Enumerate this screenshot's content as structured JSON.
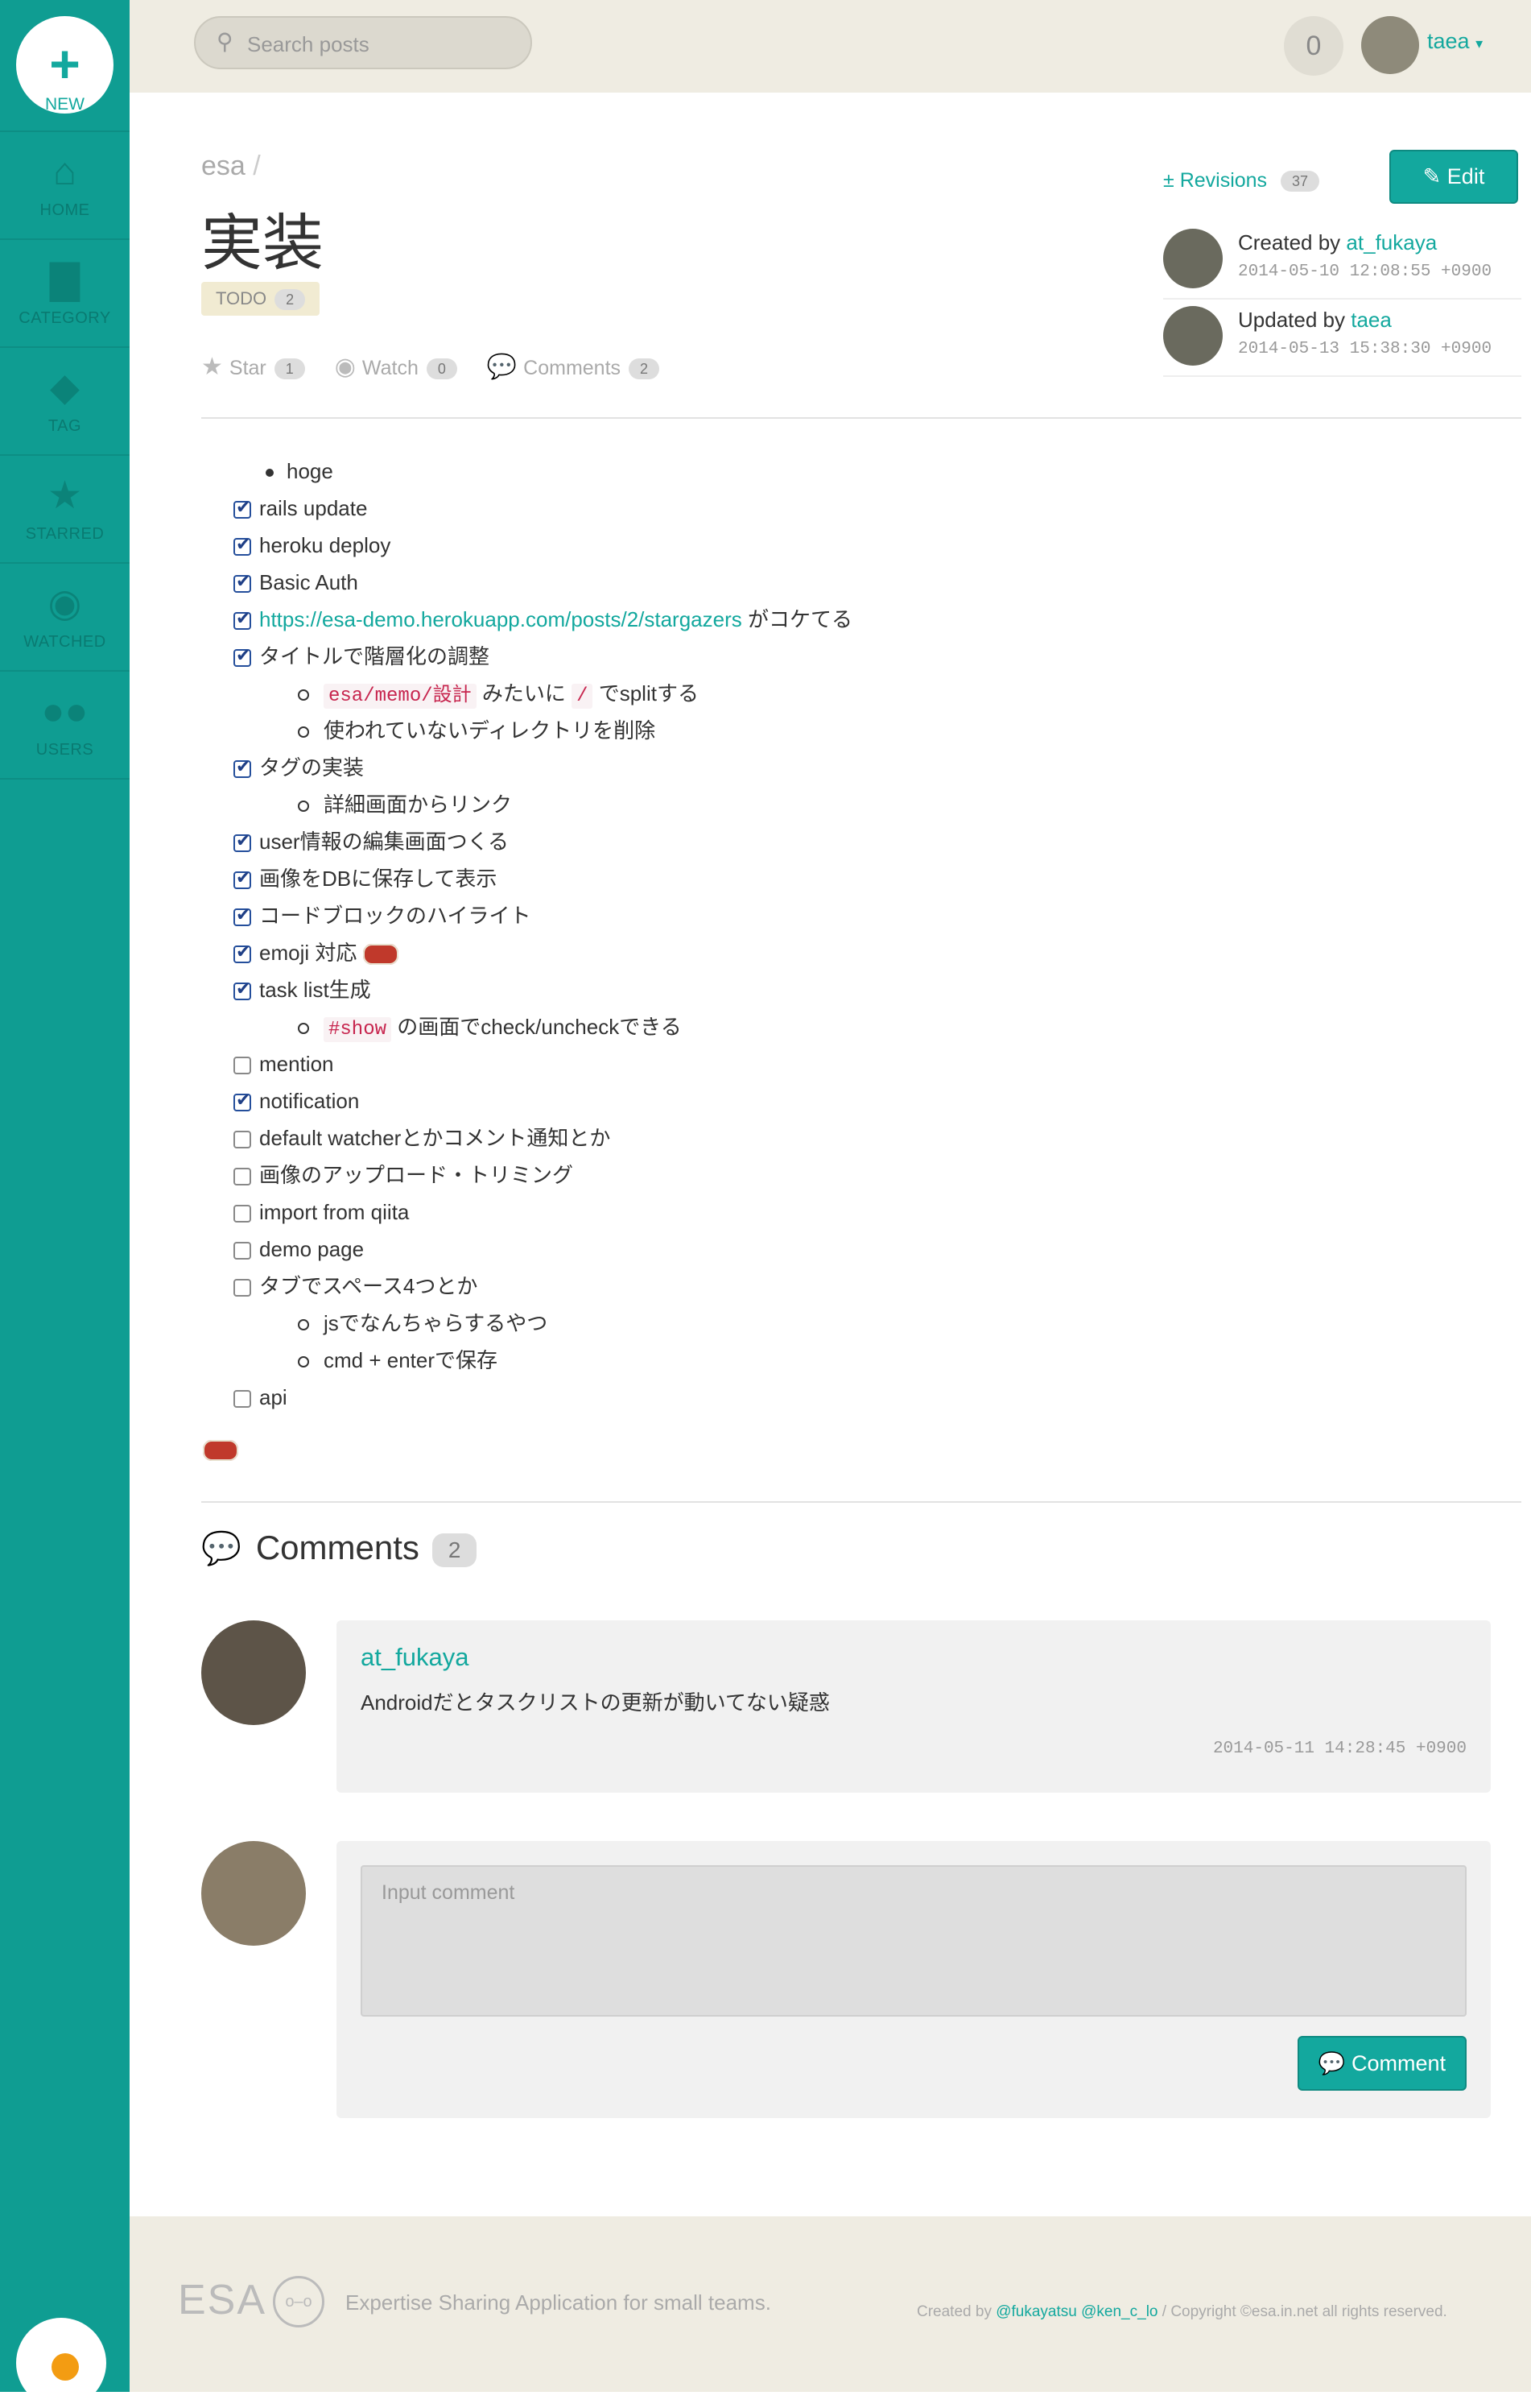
{
  "sidebar": {
    "new_label": "NEW",
    "items": [
      {
        "label": "HOME",
        "icon": "home-icon"
      },
      {
        "label": "CATEGORY",
        "icon": "folder-icon"
      },
      {
        "label": "TAG",
        "icon": "tag-icon"
      },
      {
        "label": "STARRED",
        "icon": "star-icon"
      },
      {
        "label": "WATCHED",
        "icon": "eye-icon"
      },
      {
        "label": "USERS",
        "icon": "users-icon"
      }
    ]
  },
  "topbar": {
    "search_placeholder": "Search posts",
    "notification_count": "0",
    "user_name": "taea"
  },
  "post": {
    "breadcrumb": "esa",
    "breadcrumb_sep": "/",
    "title": "実装",
    "tag": {
      "label": "TODO",
      "count": "2"
    },
    "actions": {
      "star_label": "Star",
      "star_count": "1",
      "watch_label": "Watch",
      "watch_count": "0",
      "comments_label": "Comments",
      "comments_count": "2"
    },
    "revisions_label": "Revisions",
    "revisions_count": "37",
    "edit_label": "Edit",
    "created": {
      "prefix": "Created by",
      "user": "at_fukaya",
      "time": "2014-05-10 12:08:55 +0900"
    },
    "updated": {
      "prefix": "Updated by",
      "user": "taea",
      "time": "2014-05-13 15:38:30 +0900"
    }
  },
  "body": {
    "bullet": "hoge",
    "tasks": {
      "t1": "rails update",
      "t2": "heroku deploy",
      "t3": "Basic Auth",
      "t4_link": "https://esa-demo.herokuapp.com/posts/2/stargazers",
      "t4_tail": " がコケてる",
      "t5": "タイトルで階層化の調整",
      "t5_s1_code": "esa/memo/設計",
      "t5_s1_mid": " みたいに ",
      "t5_s1_code2": "/",
      "t5_s1_tail": " でsplitする",
      "t5_s2": "使われていないディレクトリを削除",
      "t6": "タグの実装",
      "t6_s1": "詳細画面からリンク",
      "t7": "user情報の編集画面つくる",
      "t8": "画像をDBに保存して表示",
      "t9": "コードブロックのハイライト",
      "t10": "emoji 対応",
      "t11": "task list生成",
      "t11_s1_code": "#show",
      "t11_s1_tail": " の画面でcheck/uncheckできる",
      "t12": "mention",
      "t13": "notification",
      "t14": "default watcherとかコメント通知とか",
      "t15": "画像のアップロード・トリミング",
      "t16": "import from qiita",
      "t17": "demo page",
      "t18": "タブでスペース4つとか",
      "t18_s1": "jsでなんちゃらするやつ",
      "t18_s2": "cmd + enterで保存",
      "t19": "api"
    }
  },
  "comments": {
    "heading": "Comments",
    "count": "2",
    "items": [
      {
        "author": "at_fukaya",
        "text": "Androidだとタスクリストの更新が動いてない疑惑",
        "time": "2014-05-11 14:28:45 +0900"
      }
    ],
    "input_placeholder": "Input comment",
    "submit_label": "Comment"
  },
  "footer": {
    "logo": "ESA",
    "tagline": "Expertise Sharing Application for small teams.",
    "created_by": "Created by",
    "author1": "@fukayatsu",
    "author2": "@ken_c_lo",
    "sep": "/",
    "copyright": "Copyright ©esa.in.net all rights reserved."
  },
  "colors": {
    "accent": "#13a89e",
    "sidebar": "#0f9d92",
    "topbar": "#efece2"
  }
}
